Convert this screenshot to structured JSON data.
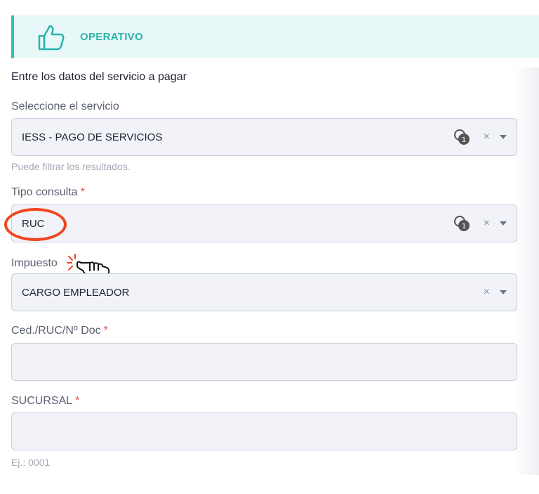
{
  "banner": {
    "status": "OPERATIVO"
  },
  "form": {
    "title": "Entre los datos del servicio a pagar",
    "service": {
      "label": "Seleccione el servicio",
      "value": "IESS - PAGO DE SERVICIOS",
      "help": "Puede filtrar los resultados.",
      "clear": "×"
    },
    "tipo": {
      "label": "Tipo consulta",
      "required": "*",
      "value": "RUC",
      "clear": "×"
    },
    "impuesto": {
      "label": "Impuesto",
      "value": "CARGO EMPLEADOR",
      "clear": "×"
    },
    "ced": {
      "label": "Ced./RUC/Nº Doc",
      "required": "*",
      "value": ""
    },
    "sucursal": {
      "label": "SUCURSAL",
      "required": "*",
      "value": "",
      "help": "Ej.: 0001"
    }
  },
  "colors": {
    "accent": "#33c2bb",
    "annotation": "#f0461f",
    "required": "#e24c4c"
  }
}
